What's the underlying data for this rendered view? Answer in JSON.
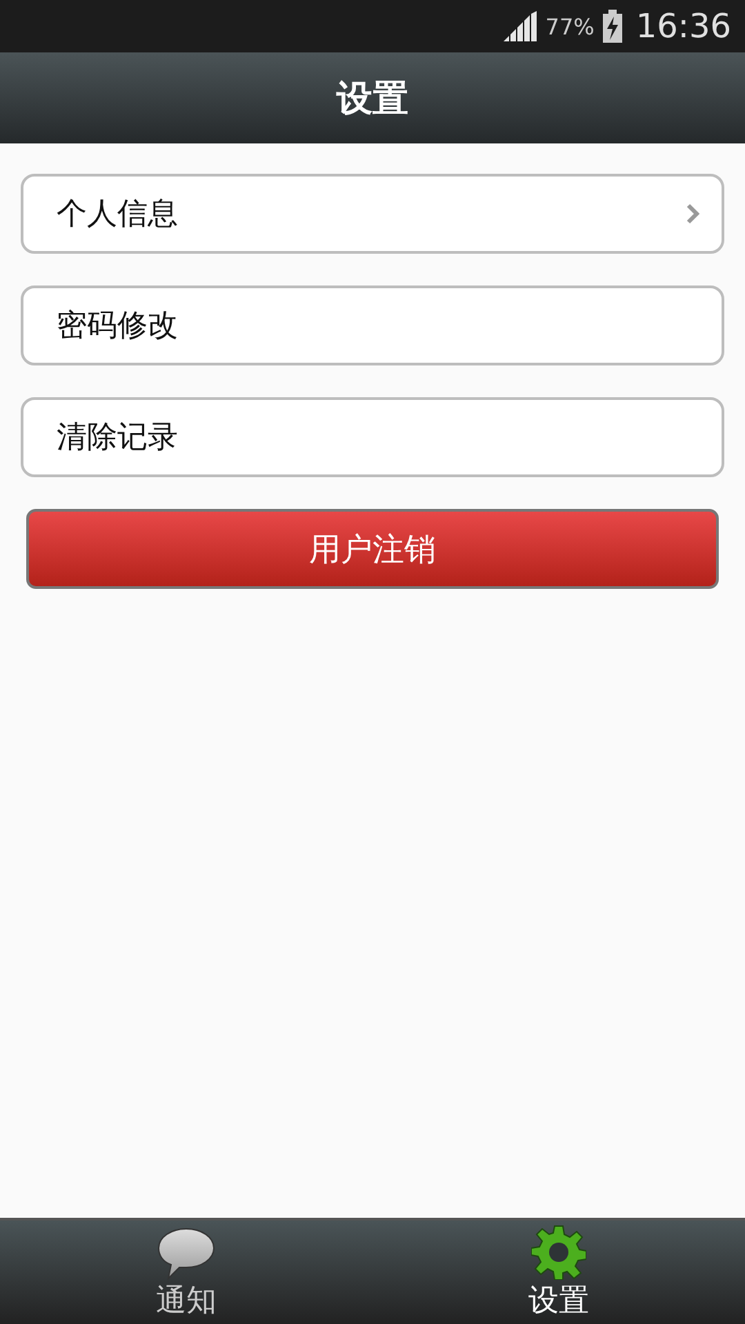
{
  "status_bar": {
    "battery": "77%",
    "time": "16:36"
  },
  "header": {
    "title": "设置"
  },
  "menu": [
    {
      "label": "个人信息",
      "chevron": true
    },
    {
      "label": "密码修改",
      "chevron": false
    },
    {
      "label": "清除记录",
      "chevron": false
    }
  ],
  "logout_button": {
    "label": "用户注销"
  },
  "tabs": [
    {
      "label": "通知",
      "kind": "chat",
      "selected": false
    },
    {
      "label": "设置",
      "kind": "gear",
      "selected": true
    }
  ]
}
